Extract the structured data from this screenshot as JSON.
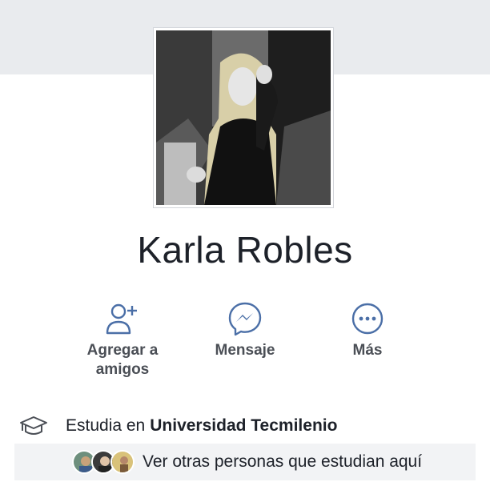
{
  "profile": {
    "name": "Karla Robles",
    "photo_icon": "profile-photo"
  },
  "actions": [
    {
      "label_line1": "Agregar a",
      "label_line2": "amigos",
      "icon": "add-friend-icon"
    },
    {
      "label": "Mensaje",
      "icon": "messenger-icon"
    },
    {
      "label": "Más",
      "icon": "more-icon"
    }
  ],
  "education": {
    "icon": "graduation-cap-icon",
    "prefix": "Estudia en",
    "school": "Universidad Tecmilenio",
    "see_others": "Ver otras personas que estudian aquí"
  },
  "colors": {
    "cover": "#e9ebee",
    "text": "#1d2129",
    "secondary": "#4b4f56",
    "icon_blue": "#4b6fa7",
    "row_bg": "#f2f3f5"
  }
}
